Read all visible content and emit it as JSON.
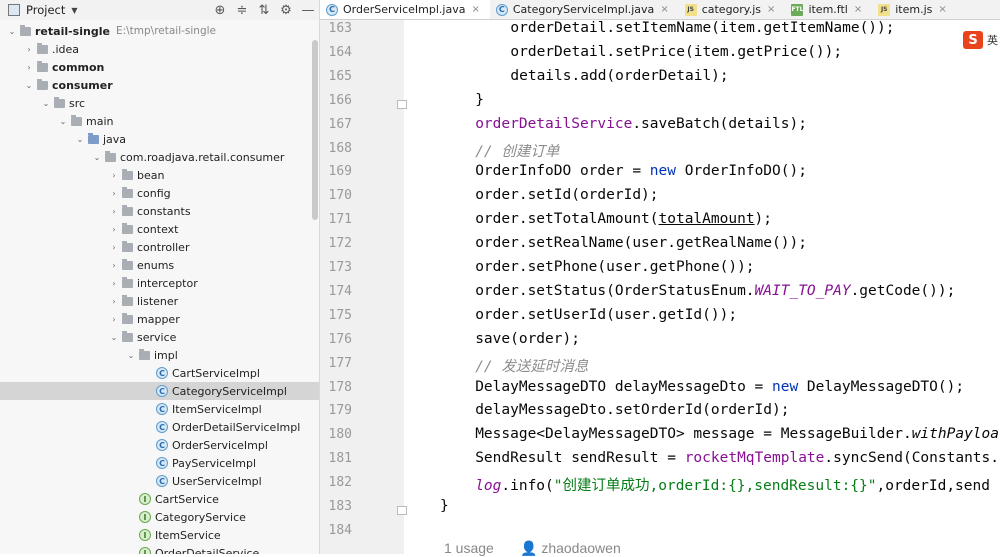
{
  "project_panel": {
    "title": "Project",
    "tools": [
      "crosshair-icon",
      "collapse-icon",
      "expand-icon",
      "gear-icon",
      "minimize-icon"
    ],
    "tree": [
      {
        "label": "retail-single",
        "path": "E:\\tmp\\retail-single",
        "depth": 0,
        "icon": "folder",
        "expanded": true,
        "bold": true
      },
      {
        "label": ".idea",
        "depth": 1,
        "icon": "folder",
        "expanded": false
      },
      {
        "label": "common",
        "depth": 1,
        "icon": "folder",
        "expanded": false,
        "bold": true
      },
      {
        "label": "consumer",
        "depth": 1,
        "icon": "folder",
        "expanded": true,
        "bold": true
      },
      {
        "label": "src",
        "depth": 2,
        "icon": "folder",
        "expanded": true
      },
      {
        "label": "main",
        "depth": 3,
        "icon": "folder",
        "expanded": true
      },
      {
        "label": "java",
        "depth": 4,
        "icon": "folder-blue",
        "expanded": true
      },
      {
        "label": "com.roadjava.retail.consumer",
        "depth": 5,
        "icon": "folder",
        "expanded": true
      },
      {
        "label": "bean",
        "depth": 6,
        "icon": "folder",
        "expanded": false
      },
      {
        "label": "config",
        "depth": 6,
        "icon": "folder",
        "expanded": false
      },
      {
        "label": "constants",
        "depth": 6,
        "icon": "folder",
        "expanded": false
      },
      {
        "label": "context",
        "depth": 6,
        "icon": "folder",
        "expanded": false
      },
      {
        "label": "controller",
        "depth": 6,
        "icon": "folder",
        "expanded": false
      },
      {
        "label": "enums",
        "depth": 6,
        "icon": "folder",
        "expanded": false
      },
      {
        "label": "interceptor",
        "depth": 6,
        "icon": "folder",
        "expanded": false
      },
      {
        "label": "listener",
        "depth": 6,
        "icon": "folder",
        "expanded": false
      },
      {
        "label": "mapper",
        "depth": 6,
        "icon": "folder",
        "expanded": false
      },
      {
        "label": "service",
        "depth": 6,
        "icon": "folder",
        "expanded": true
      },
      {
        "label": "impl",
        "depth": 7,
        "icon": "folder",
        "expanded": true
      },
      {
        "label": "CartServiceImpl",
        "depth": 8,
        "icon": "class"
      },
      {
        "label": "CategoryServiceImpl",
        "depth": 8,
        "icon": "class",
        "selected": true
      },
      {
        "label": "ItemServiceImpl",
        "depth": 8,
        "icon": "class"
      },
      {
        "label": "OrderDetailServiceImpl",
        "depth": 8,
        "icon": "class"
      },
      {
        "label": "OrderServiceImpl",
        "depth": 8,
        "icon": "class"
      },
      {
        "label": "PayServiceImpl",
        "depth": 8,
        "icon": "class"
      },
      {
        "label": "UserServiceImpl",
        "depth": 8,
        "icon": "class"
      },
      {
        "label": "CartService",
        "depth": 7,
        "icon": "interface"
      },
      {
        "label": "CategoryService",
        "depth": 7,
        "icon": "interface"
      },
      {
        "label": "ItemService",
        "depth": 7,
        "icon": "interface"
      },
      {
        "label": "OrderDetailService",
        "depth": 7,
        "icon": "interface"
      }
    ]
  },
  "editor": {
    "tabs": [
      {
        "label": "OrderServiceImpl.java",
        "icon": "c",
        "active": true
      },
      {
        "label": "CategoryServiceImpl.java",
        "icon": "c",
        "active": false
      },
      {
        "label": "category.js",
        "icon": "js",
        "active": false
      },
      {
        "label": "item.ftl",
        "icon": "ftl",
        "active": false
      },
      {
        "label": "item.js",
        "icon": "js",
        "active": false
      }
    ],
    "lines": [
      {
        "n": "163",
        "indent": 8,
        "segs": [
          [
            "t",
            "orderDetail.setItemName(item.getItemName());"
          ]
        ]
      },
      {
        "n": "164",
        "indent": 8,
        "segs": [
          [
            "t",
            "orderDetail.setPrice(item.getPrice());"
          ]
        ]
      },
      {
        "n": "165",
        "indent": 8,
        "segs": [
          [
            "t",
            "details.add(orderDetail);"
          ]
        ]
      },
      {
        "n": "166",
        "indent": 4,
        "segs": [
          [
            "t",
            "}"
          ]
        ]
      },
      {
        "n": "167",
        "indent": 4,
        "segs": [
          [
            "field",
            "orderDetailService"
          ],
          [
            "t",
            ".saveBatch(details);"
          ]
        ]
      },
      {
        "n": "168",
        "indent": 4,
        "segs": [
          [
            "comment",
            "// 创建订单"
          ]
        ]
      },
      {
        "n": "169",
        "indent": 4,
        "segs": [
          [
            "t",
            "OrderInfoDO order = "
          ],
          [
            "kw",
            "new"
          ],
          [
            "t",
            " OrderInfoDO();"
          ]
        ]
      },
      {
        "n": "170",
        "indent": 4,
        "segs": [
          [
            "t",
            "order.setId(orderId);"
          ]
        ]
      },
      {
        "n": "171",
        "indent": 4,
        "segs": [
          [
            "t",
            "order.setTotalAmount("
          ],
          [
            "u",
            "totalAmount"
          ],
          [
            "t",
            ");"
          ]
        ]
      },
      {
        "n": "172",
        "indent": 4,
        "segs": [
          [
            "t",
            "order.setRealName(user.getRealName());"
          ]
        ]
      },
      {
        "n": "173",
        "indent": 4,
        "segs": [
          [
            "t",
            "order.setPhone(user.getPhone());"
          ]
        ]
      },
      {
        "n": "174",
        "indent": 4,
        "segs": [
          [
            "t",
            "order.setStatus(OrderStatusEnum."
          ],
          [
            "static",
            "WAIT_TO_PAY"
          ],
          [
            "t",
            ".getCode());"
          ]
        ]
      },
      {
        "n": "175",
        "indent": 4,
        "segs": [
          [
            "t",
            "order.setUserId(user.getId());"
          ]
        ]
      },
      {
        "n": "176",
        "indent": 4,
        "segs": [
          [
            "t",
            "save(order);"
          ]
        ]
      },
      {
        "n": "177",
        "indent": 4,
        "segs": [
          [
            "comment",
            "// 发送延时消息"
          ]
        ]
      },
      {
        "n": "178",
        "indent": 4,
        "segs": [
          [
            "t",
            "DelayMessageDTO delayMessageDto = "
          ],
          [
            "kw",
            "new"
          ],
          [
            "t",
            " DelayMessageDTO();"
          ]
        ]
      },
      {
        "n": "179",
        "indent": 4,
        "segs": [
          [
            "t",
            "delayMessageDto.setOrderId(orderId);"
          ]
        ]
      },
      {
        "n": "180",
        "indent": 4,
        "segs": [
          [
            "t",
            "Message<DelayMessageDTO> message = MessageBuilder."
          ],
          [
            "italic",
            "withPayloa"
          ]
        ]
      },
      {
        "n": "181",
        "indent": 4,
        "segs": [
          [
            "t",
            "SendResult sendResult = "
          ],
          [
            "field",
            "rocketMqTemplate"
          ],
          [
            "t",
            ".syncSend(Constants."
          ]
        ]
      },
      {
        "n": "182",
        "indent": 4,
        "segs": [
          [
            "static",
            "log"
          ],
          [
            "t",
            ".info("
          ],
          [
            "str",
            "\"创建订单成功,orderId:{},sendResult:{}\""
          ],
          [
            "t",
            ",orderId,send"
          ]
        ]
      },
      {
        "n": "183",
        "indent": 0,
        "segs": [
          [
            "t",
            "}"
          ]
        ]
      },
      {
        "n": "184",
        "indent": 0,
        "segs": [
          [
            "t",
            ""
          ]
        ]
      }
    ],
    "usage_hint": "1 usage",
    "author_hint": "zhaodaowen"
  },
  "ime": {
    "logo": "S",
    "label": "英"
  },
  "colors": {
    "keyword": "#0033b3",
    "field": "#871094",
    "comment": "#8c8c8c",
    "string": "#067d17",
    "accent": "#4a86e8"
  }
}
